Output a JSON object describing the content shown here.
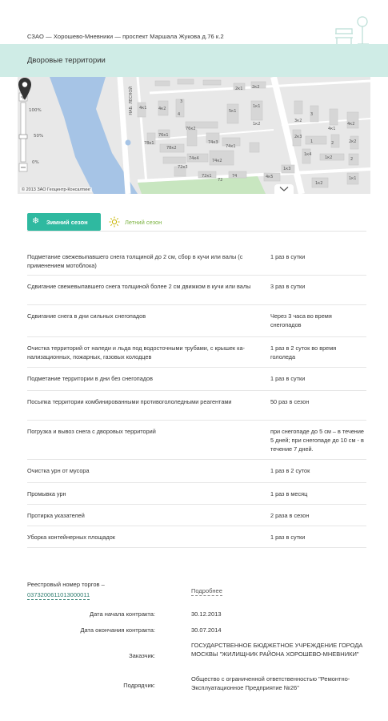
{
  "header": {
    "breadcrumb": "СЗАО — Хорошево-Мневники — проспект Маршала Жукова д.76 к.2",
    "page_title": "Дворовые территории"
  },
  "map": {
    "zoom_levels": [
      "100%",
      "50%",
      "0%"
    ],
    "copyright": "© 2013 ЗАО Геоцентр-Консалтинг",
    "street_label": "НАБ. ЛЕСНОЙ",
    "buildings": [
      "4к1",
      "4к2",
      "3",
      "4",
      "5к1",
      "76к2",
      "74к3",
      "74к1",
      "76к1",
      "78к1",
      "78к2",
      "74к4",
      "72к3",
      "74к2",
      "72к1",
      "72",
      "74",
      "1к1",
      "1к2",
      "2к1",
      "2к2",
      "3к2",
      "2к3",
      "3",
      "4к1",
      "4к2",
      "1",
      "2",
      "1к4",
      "1к2",
      "2",
      "1к2",
      "1к1",
      "1к3",
      "4к5",
      "2к2"
    ]
  },
  "seasons": {
    "winter_label": "Зимний сезон",
    "summer_label": "Летний сезон",
    "active": "winter"
  },
  "tasks": [
    {
      "name": "Подметание свежевыпавшего снега толщиной до 2 см, сбор в кучи или валы (с применением мотоблока)",
      "freq": "1 раз в сутки"
    },
    {
      "name": "Сдвигание свежевыпавшего снега толщиной более 2 см движком в кучи или валы",
      "freq": "3 раз в сутки"
    },
    {
      "name": "Сдвигание снега в дни сильных снегопадов",
      "freq": "Через 3 часа во время снегопадов"
    },
    {
      "name": "Очистка территорий от наледи и льда под водосточными трубами, с крышек ка-нализационных, пожарных, газовых колодцев",
      "freq": "1 раз в 2 суток во время гололеда"
    },
    {
      "name": "Подметание территории в дни без снегопадов",
      "freq": "1 раз в сутки"
    },
    {
      "name": "Посыпка территории комбинированными противогололедными реагентами",
      "freq": "50 раз в сезон"
    },
    {
      "name": "Погрузка и вывоз снега с дворовых территорий",
      "freq": "при снегопаде до 5 см – в течение 5 дней; при снегопаде до 10 см - в течение 7 дней."
    },
    {
      "name": "Очистка урн от мусора",
      "freq": "1 раз в 2 суток"
    },
    {
      "name": "Промывка урн",
      "freq": "1 раз в месяц"
    },
    {
      "name": "Протирка указателей",
      "freq": "2 раза в сезон"
    },
    {
      "name": "Уборка контейнерных площадок",
      "freq": "1 раз в сутки"
    }
  ],
  "contract": {
    "registry_label": "Реестровый номер торгов –",
    "registry_number": "0373200611013000011",
    "more_label": "Подробнее",
    "start_label": "Дата начала контракта:",
    "start_value": "30.12.2013",
    "end_label": "Дата окончания контракта:",
    "end_value": "30.07.2014",
    "customer_label": "Заказчик:",
    "customer_value": "ГОСУДАРСТВЕННОЕ БЮДЖЕТНОЕ УЧРЕЖДЕНИЕ ГОРОДА МОСКВЫ \"ЖИЛИЩНИК РАЙОНА ХОРОШЕВО-МНЕВНИКИ\"",
    "contractor_label": "Подрядчик:",
    "contractor_value": "Общество с ограниченной ответственностью \"Ремонтно-Эксплуатационное Предприятие №26\""
  },
  "colors": {
    "accent": "#2fb9a0",
    "title_bar": "#cfece6",
    "summer": "#7cb342",
    "link": "#2e7d6f"
  }
}
